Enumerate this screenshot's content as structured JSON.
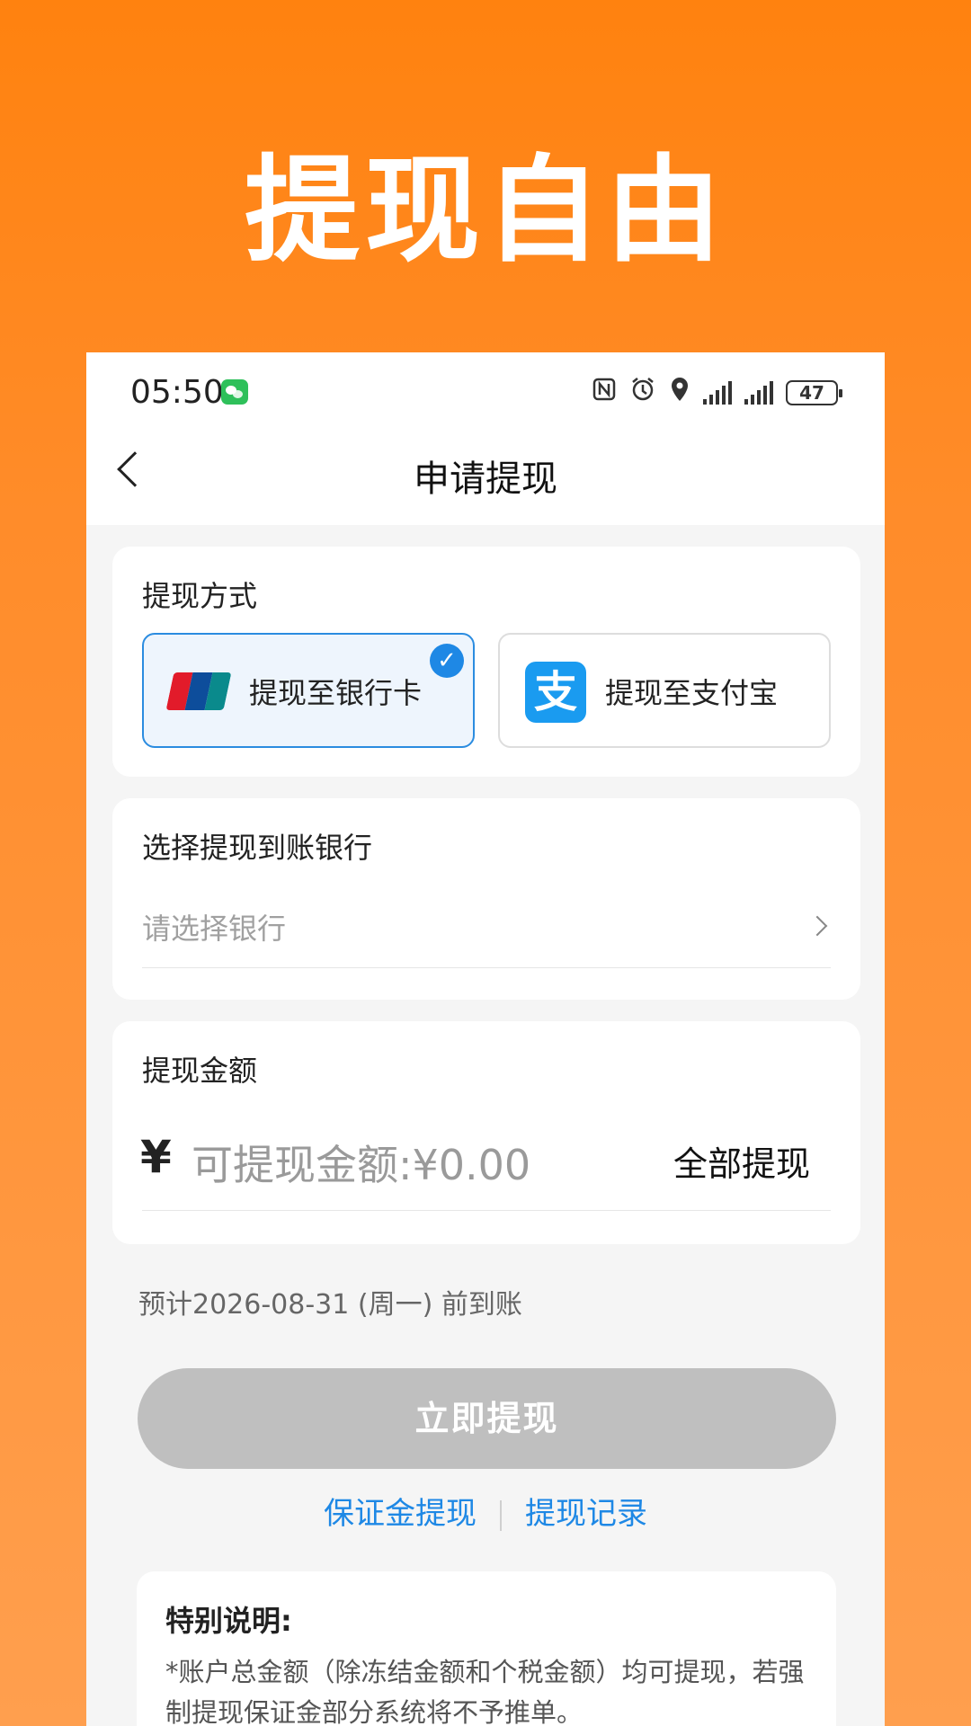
{
  "hero": {
    "title": "提现自由"
  },
  "status_bar": {
    "time": "05:50",
    "battery": "47"
  },
  "nav": {
    "title": "申请提现"
  },
  "methods": {
    "label": "提现方式",
    "bank": {
      "label": "提现至银行卡",
      "selected": true
    },
    "alipay": {
      "label": "提现至支付宝",
      "icon_glyph": "支"
    },
    "check_glyph": "✓"
  },
  "bank_select": {
    "label": "选择提现到账银行",
    "placeholder": "请选择银行"
  },
  "amount": {
    "label": "提现金额",
    "currency": "¥",
    "placeholder": "可提现金额:¥0.00",
    "withdraw_all": "全部提现"
  },
  "eta": "预计2026-08-31 (周一) 前到账",
  "submit": "立即提现",
  "links": {
    "deposit": "保证金提现",
    "records": "提现记录"
  },
  "notice": {
    "title": "特别说明:",
    "text": "*账户总金额（除冻结金额和个税金额）均可提现，若强制提现保证金部分系统将不予推单。"
  },
  "colors": {
    "accent": "#1e88e5",
    "background_orange": "#ff8c2a",
    "disabled_button": "#bfbfbf",
    "alipay_blue": "#1a9bf0"
  }
}
